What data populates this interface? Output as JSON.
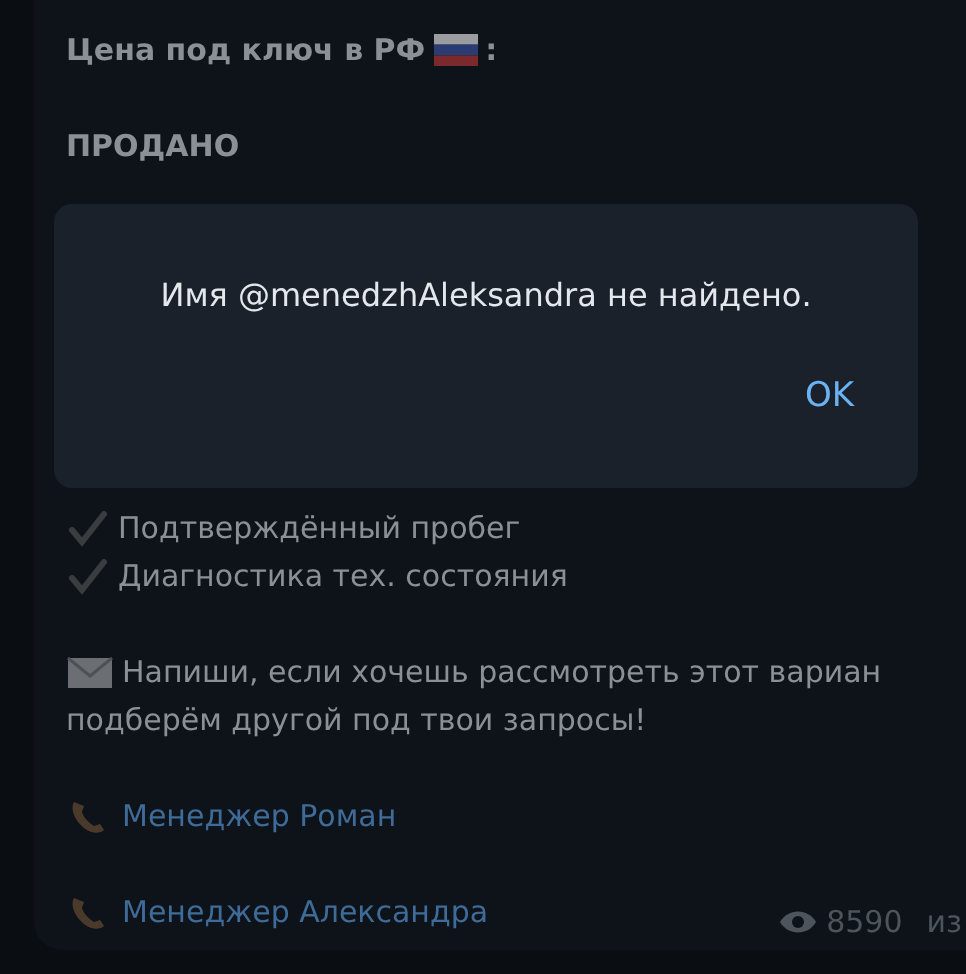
{
  "message": {
    "price_label": "Цена под ключ в РФ",
    "price_suffix": ":",
    "status": "ПРОДАНО",
    "features": [
      {
        "text": "Подтверждённый пробег"
      },
      {
        "text": "Диагностика тех. состояния"
      }
    ],
    "call_to_action": "Напиши, если хочешь рассмотреть этот вариан",
    "call_to_action_2": "подберём другой под твои запросы!",
    "contacts": [
      {
        "name": "Менеджер Роман"
      },
      {
        "name": "Менеджер Александра"
      }
    ],
    "views": "8590",
    "edited": "из"
  },
  "dialog": {
    "text": "Имя @menedzhAleksandra не найдено.",
    "button": "OK"
  }
}
